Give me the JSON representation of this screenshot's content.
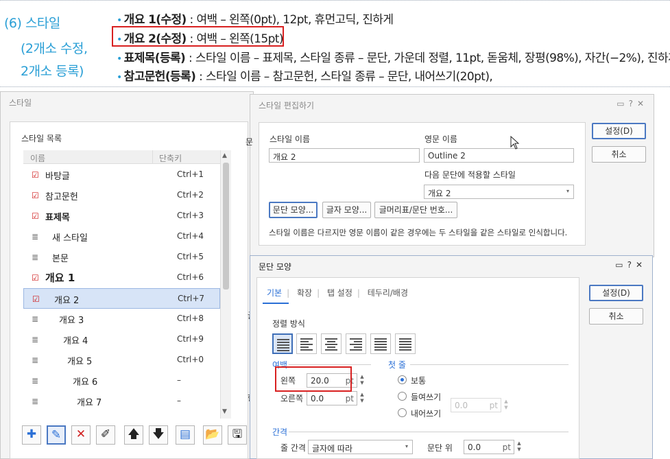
{
  "doc": {
    "section_line1": "(6) 스타일",
    "section_line2": "(2개소 수정,",
    "section_line3": "2개소 등록)",
    "bullets": [
      {
        "bold": "개요 1(수정)",
        "rest": " : 여백 – 왼쪽(0pt), 12pt, 휴먼고딕, 진하게"
      },
      {
        "bold": "개요 2(수정)",
        "rest": " : 여백 – 왼쪽(15pt)"
      },
      {
        "bold": "표제목(등록)",
        "rest": " : 스타일 이름 – 표제목, 스타일 종류 – 문단, 가운데 정렬, 11pt, 돋움체, 장평(98%), 자간(−2%), 진하게"
      },
      {
        "bold": "참고문헌(등록)",
        "rest": " : 스타일 이름 – 참고문헌, 스타일 종류 – 문단, 내어쓰기(20pt),"
      }
    ]
  },
  "style_dialog": {
    "title": "스타일",
    "list_label": "스타일 목록",
    "col_name": "이름",
    "col_shortcut": "단축키",
    "rows": [
      {
        "name": "바탕글",
        "key": "Ctrl+1",
        "icon": "check"
      },
      {
        "name": "참고문헌",
        "key": "Ctrl+2",
        "icon": "check"
      },
      {
        "name": "표제목",
        "key": "Ctrl+3",
        "icon": "check"
      },
      {
        "name": "새 스타일",
        "key": "Ctrl+4",
        "icon": "lines"
      },
      {
        "name": "본문",
        "key": "Ctrl+5",
        "icon": "lines"
      },
      {
        "name": "개요 1",
        "key": "Ctrl+6",
        "icon": "check"
      },
      {
        "name": "개요 2",
        "key": "Ctrl+7",
        "icon": "check"
      },
      {
        "name": "개요 3",
        "key": "Ctrl+8",
        "icon": "lines"
      },
      {
        "name": "개요 4",
        "key": "Ctrl+9",
        "icon": "lines"
      },
      {
        "name": "개요 5",
        "key": "Ctrl+0",
        "icon": "lines"
      },
      {
        "name": "개요 6",
        "key": "–",
        "icon": "lines"
      },
      {
        "name": "개요 7",
        "key": "–",
        "icon": "lines"
      }
    ],
    "toolbar_icons": [
      "add-icon",
      "edit-icon",
      "delete-icon",
      "rename-icon",
      "move-up-icon",
      "move-down-icon",
      "import-icon",
      "open-folder-icon",
      "save-icon"
    ],
    "side_glyph_1": "문",
    "side_glyph_2": "글",
    "side_glyph_3": "한"
  },
  "edit_dialog": {
    "title": "스타일 편집하기",
    "style_name_label": "스타일 이름",
    "style_name_value": "개요 2",
    "english_name_label": "영문 이름",
    "english_name_value": "Outline 2",
    "next_style_label": "다음 문단에 적용할 스타일",
    "next_style_value": "개요 2",
    "btn_paragraph": "문단 모양...",
    "btn_char": "글자 모양...",
    "btn_bullet": "글머리표/문단 번호...",
    "note": "스타일 이름은 다르지만 영문 이름이 같은 경우에는 두 스타일을 같은 스타일로 인식합니다.",
    "ok": "설정(D)",
    "cancel": "취소"
  },
  "para_dialog": {
    "title": "문단 모양",
    "tabs": [
      "기본",
      "확장",
      "탭 설정",
      "테두리/배경"
    ],
    "align_label": "정렬 방식",
    "margin_label": "여백",
    "left_label": "왼쪽",
    "left_value": "20.0",
    "right_label": "오른쪽",
    "right_value": "0.0",
    "unit": "pt",
    "first_line_label": "첫 줄",
    "radio_normal": "보통",
    "radio_indent": "들여쓰기",
    "radio_outdent": "내어쓰기",
    "first_line_value": "0.0",
    "spacing_label": "간격",
    "line_spacing_label": "줄 간격",
    "line_spacing_value": "글자에 따라",
    "para_above_label": "문단 위",
    "para_above_value": "0.0",
    "ok": "설정(D)",
    "cancel": "취소"
  },
  "colors": {
    "accent": "#2a9fd6",
    "highlight_box": "#d82020",
    "selection": "#d7e4f7"
  }
}
